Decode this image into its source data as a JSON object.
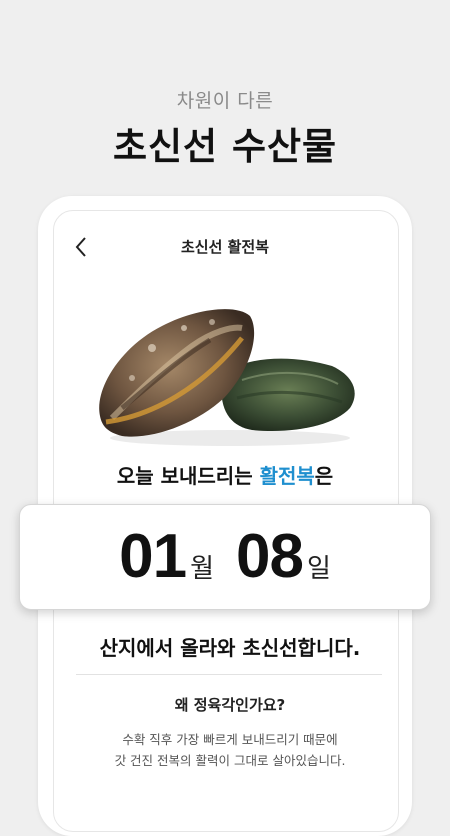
{
  "hero": {
    "subtitle": "차원이 다른",
    "headline": "초신선 수산물"
  },
  "screen": {
    "title": "초신선 활전복",
    "back_icon": "chevron-left-icon"
  },
  "product": {
    "image_alt": "abalone"
  },
  "today": {
    "prefix": "오늘 보내드리는 ",
    "highlight": "활전복",
    "suffix": "은",
    "accent_color": "#1f8fcf"
  },
  "date": {
    "month": "01",
    "month_unit": "월",
    "day": "08",
    "day_unit": "일"
  },
  "origin": {
    "text": "산지에서 올라와 초신선합니다."
  },
  "faq": {
    "question": "왜 정육각인가요?",
    "answer_line1": "수확 직후 가장 빠르게 보내드리기 때문에",
    "answer_line2": "갓 건진 전복의 활력이 그대로 살아있습니다."
  }
}
